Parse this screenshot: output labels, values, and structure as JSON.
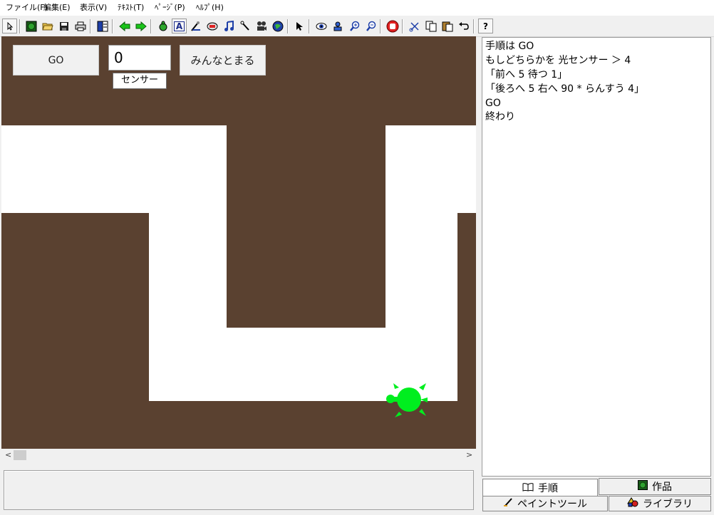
{
  "menu": [
    "ファイル(F)",
    "編集(E)",
    "表示(V)",
    "ﾃｷｽﾄ(T)",
    "ﾍﾟｰｼﾞ(P)",
    "ﾍﾙﾌﾟ(H)"
  ],
  "toolbar": {
    "icons": [
      "cursor-small-icon",
      "globe-icon",
      "open-folder-icon",
      "save-icon",
      "print-icon",
      "page-layout-icon",
      "back-arrow-icon",
      "forward-arrow-icon",
      "turtle-icon",
      "text-icon",
      "paint-icon",
      "stamp-icon",
      "music-icon",
      "pen-icon",
      "movie-icon",
      "web-icon",
      "pointer-icon",
      "eye-icon",
      "shout-icon",
      "zoom-in-icon",
      "zoom-out-icon",
      "stop-icon",
      "cut-icon",
      "copy-icon",
      "paste-icon",
      "undo-icon",
      "help-icon"
    ],
    "help_glyph": "?"
  },
  "stage": {
    "go_button": "GO",
    "number_field": "0",
    "sensor_label": "センサー",
    "stop_all_button": "みんなとまる",
    "background_color": "#5a4130",
    "path_color": "#ffffff",
    "turtle_color": "#00ee1f"
  },
  "script": {
    "lines": [
      "手順は GO",
      "もしどちらかを 光センサー ＞ 4",
      "「前へ 5 待つ 1」",
      "「後ろへ 5 右へ 90 * らんすう 4」",
      "GO",
      "終わり"
    ]
  },
  "tabs": {
    "procedure": "手順",
    "works": "作品",
    "paint_tool": "ペイントツール",
    "library": "ライブラリ"
  },
  "scrollbar": {
    "left_arrow": "<",
    "right_arrow": ">"
  }
}
